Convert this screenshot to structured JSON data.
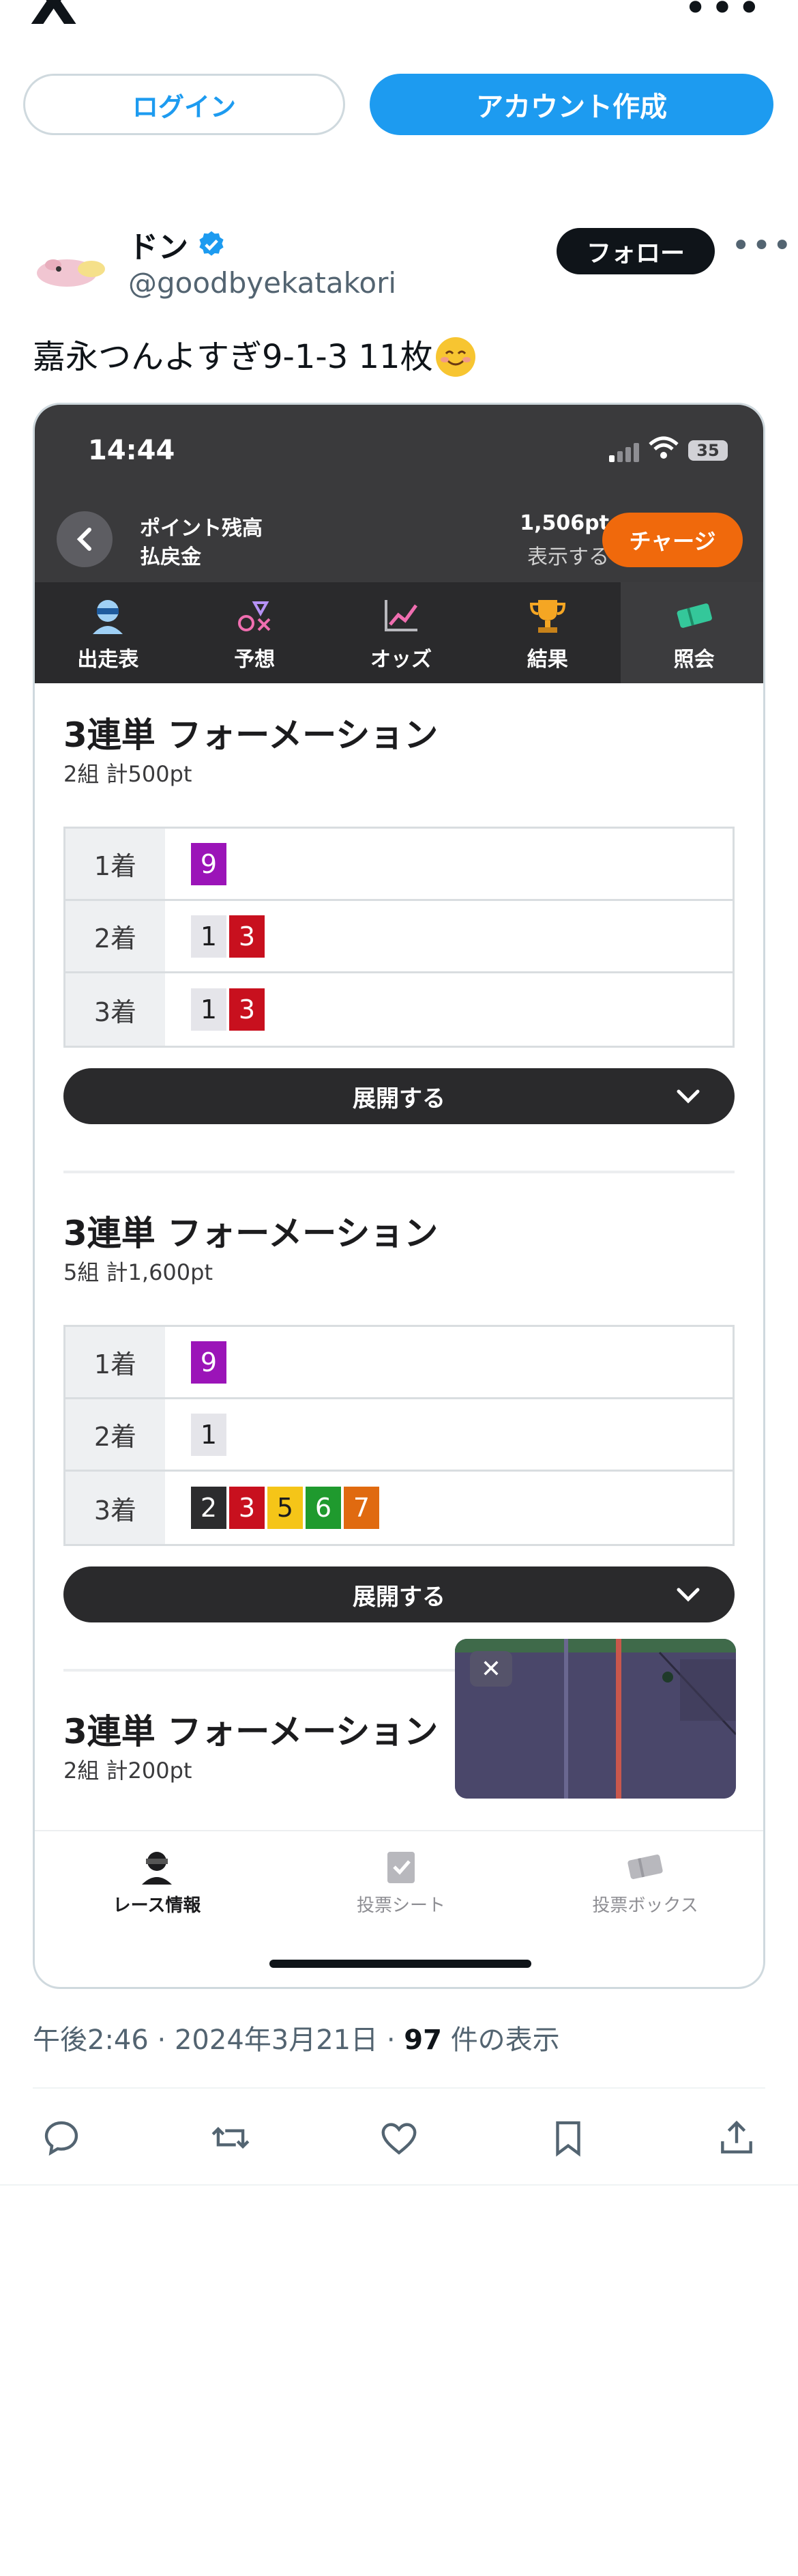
{
  "header": {
    "logo": "X",
    "more_icon": "more-icon"
  },
  "auth": {
    "login_label": "ログイン",
    "signup_label": "アカウント作成"
  },
  "author": {
    "name": "ドン",
    "handle": "@goodbyekatakori",
    "verified": true,
    "follow_label": "フォロー"
  },
  "tweet": {
    "text": "嘉永つんよすぎ9-1-3 11枚",
    "emoji": "smiling-face-emoji"
  },
  "phone": {
    "time": "14:44",
    "battery": "35",
    "points": {
      "label1": "ポイント残高",
      "label2": "払戻金",
      "value": "1,506pt",
      "show_label": "表示する",
      "charge_label": "チャージ"
    },
    "tabs": [
      {
        "label": "出走表",
        "icon": "racer-icon",
        "active": false
      },
      {
        "label": "予想",
        "icon": "prediction-icon",
        "active": false
      },
      {
        "label": "オッズ",
        "icon": "chart-icon",
        "active": false
      },
      {
        "label": "結果",
        "icon": "trophy-icon",
        "active": false
      },
      {
        "label": "照会",
        "icon": "ticket-icon",
        "active": true
      }
    ],
    "bets": [
      {
        "title": "3連単 フォーメーション",
        "sub": "2組 計500pt",
        "rows": [
          {
            "label": "1着",
            "nums": [
              "9"
            ]
          },
          {
            "label": "2着",
            "nums": [
              "1",
              "3"
            ]
          },
          {
            "label": "3着",
            "nums": [
              "1",
              "3"
            ]
          }
        ],
        "expand_label": "展開する"
      },
      {
        "title": "3連単 フォーメーション",
        "sub": "5組 計1,600pt",
        "rows": [
          {
            "label": "1着",
            "nums": [
              "9"
            ]
          },
          {
            "label": "2着",
            "nums": [
              "1"
            ]
          },
          {
            "label": "3着",
            "nums": [
              "2",
              "3",
              "5",
              "6",
              "7"
            ]
          }
        ],
        "expand_label": "展開する"
      },
      {
        "title": "3連単 フォーメーション",
        "sub": "2組 計200pt"
      }
    ],
    "num_colors": {
      "1": {
        "bg": "#e5e5ea",
        "fg": "#1c1c1e"
      },
      "2": {
        "bg": "#2c2c2e",
        "fg": "#ffffff"
      },
      "3": {
        "bg": "#c8101e",
        "fg": "#ffffff"
      },
      "5": {
        "bg": "#f5c518",
        "fg": "#1c1c1e"
      },
      "6": {
        "bg": "#1f9a2e",
        "fg": "#ffffff"
      },
      "7": {
        "bg": "#e06a10",
        "fg": "#ffffff"
      },
      "9": {
        "bg": "#9b14b8",
        "fg": "#ffffff"
      }
    },
    "bottom_nav": [
      {
        "label": "レース情報",
        "icon": "racer-icon",
        "active": true
      },
      {
        "label": "投票シート",
        "icon": "vote-sheet-icon",
        "active": false
      },
      {
        "label": "投票ボックス",
        "icon": "vote-box-icon",
        "active": false
      }
    ]
  },
  "meta": {
    "time": "午後2:46",
    "date": "2024年3月21日",
    "views": "97",
    "views_suffix": "件の表示",
    "sep": "·"
  },
  "actions": [
    "reply-icon",
    "retweet-icon",
    "like-icon",
    "bookmark-icon",
    "share-icon"
  ]
}
